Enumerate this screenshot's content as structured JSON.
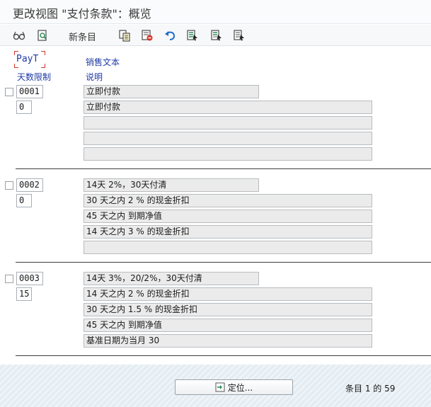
{
  "window": {
    "title": "更改视图 \"支付条款\"：概览"
  },
  "toolbar": {
    "new_entries_label": "新条目"
  },
  "columns": {
    "payt": "PayT",
    "day_limit": "天数限制",
    "sales_text": "销售文本",
    "explanation": "说明"
  },
  "rows": [
    {
      "payt": "0001",
      "day_limit": "0",
      "sales_text": "立即付款",
      "explanations": [
        "立即付款",
        "",
        "",
        ""
      ]
    },
    {
      "payt": "0002",
      "day_limit": "0",
      "sales_text": "14天 2%，30天付清",
      "explanations": [
        "30 天之内 2 % 的现金折扣",
        "45 天之内 到期净值",
        "14 天之内 3 % 的现金折扣",
        ""
      ]
    },
    {
      "payt": "0003",
      "day_limit": "15",
      "sales_text": "14天 3%，20/2%，30天付清",
      "explanations": [
        "14 天之内 2 % 的现金折扣",
        "30 天之内 1.5 % 的现金折扣",
        "45 天之内 到期净值",
        "基准日期为当月 30"
      ]
    }
  ],
  "footer": {
    "position_button": "定位...",
    "entry_info": "条目 1 的 59"
  },
  "icons": [
    "glasses-icon",
    "find-icon",
    "copy-icon",
    "delete-icon",
    "undo-icon",
    "select-all-icon",
    "select-block-icon",
    "deselect-all-icon",
    "position-icon"
  ],
  "colors": {
    "header_text": "#1f3aa6",
    "field_bg": "#ebebeb",
    "selection_marker": "#d9342b"
  }
}
